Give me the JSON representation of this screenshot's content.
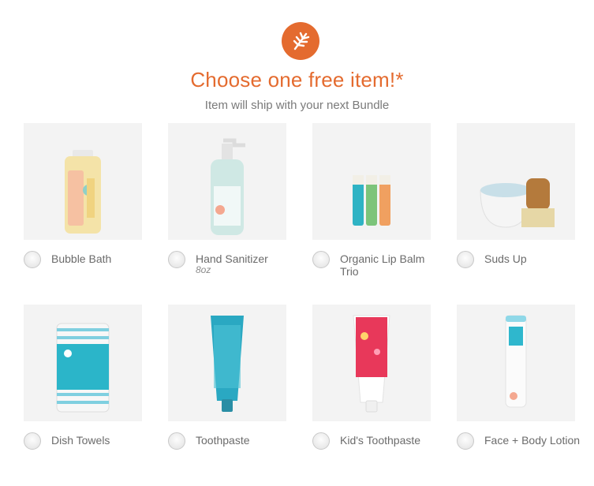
{
  "header": {
    "logo_icon": "leaf-icon",
    "title": "Choose one free item!*",
    "subtitle": "Item will ship with your next Bundle",
    "accent_color": "#e46b2f"
  },
  "items": [
    {
      "label": "Bubble Bath",
      "sub": ""
    },
    {
      "label": "Hand Sanitizer",
      "sub": "8oz"
    },
    {
      "label": "Organic Lip Balm Trio",
      "sub": ""
    },
    {
      "label": "Suds Up",
      "sub": ""
    },
    {
      "label": "Dish Towels",
      "sub": ""
    },
    {
      "label": "Toothpaste",
      "sub": ""
    },
    {
      "label": "Kid's Toothpaste",
      "sub": ""
    },
    {
      "label": "Face + Body Lotion",
      "sub": ""
    }
  ]
}
